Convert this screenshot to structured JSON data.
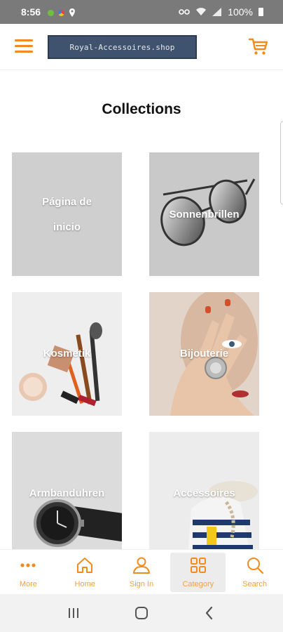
{
  "status_bar": {
    "time": "8:56",
    "battery": "100%",
    "notification_colors": [
      "#6fbf3f",
      "#e0443c",
      "#f4c20d"
    ]
  },
  "header": {
    "logo_text": "Royal-Accessoires.shop",
    "accent_color": "#f08c1e",
    "menu_icon": "hamburger-icon",
    "cart_icon": "cart-icon"
  },
  "page": {
    "title": "Collections"
  },
  "collections": [
    {
      "label_line1": "Página de",
      "label_line2": "inicio",
      "art": "none"
    },
    {
      "label_line1": "Sonnenbrillen",
      "label_line2": "",
      "art": "sunglasses"
    },
    {
      "label_line1": "Kosmetik",
      "label_line2": "",
      "art": "cosmetics"
    },
    {
      "label_line1": "Bijouterie",
      "label_line2": "",
      "art": "ring-hand"
    },
    {
      "label_line1": "Armbanduhren",
      "label_line2": "",
      "art": "watch"
    },
    {
      "label_line1": "Accessoires",
      "label_line2": "",
      "art": "bag"
    }
  ],
  "bottom_nav": [
    {
      "label": "More",
      "icon": "more-dots-icon"
    },
    {
      "label": "Home",
      "icon": "home-icon"
    },
    {
      "label": "Sign In",
      "icon": "user-icon"
    },
    {
      "label": "Category",
      "icon": "grid-icon",
      "active": true
    },
    {
      "label": "Search",
      "icon": "search-icon"
    }
  ],
  "system_nav": {
    "buttons": [
      "recents-icon",
      "home-circle-icon",
      "back-icon"
    ]
  }
}
